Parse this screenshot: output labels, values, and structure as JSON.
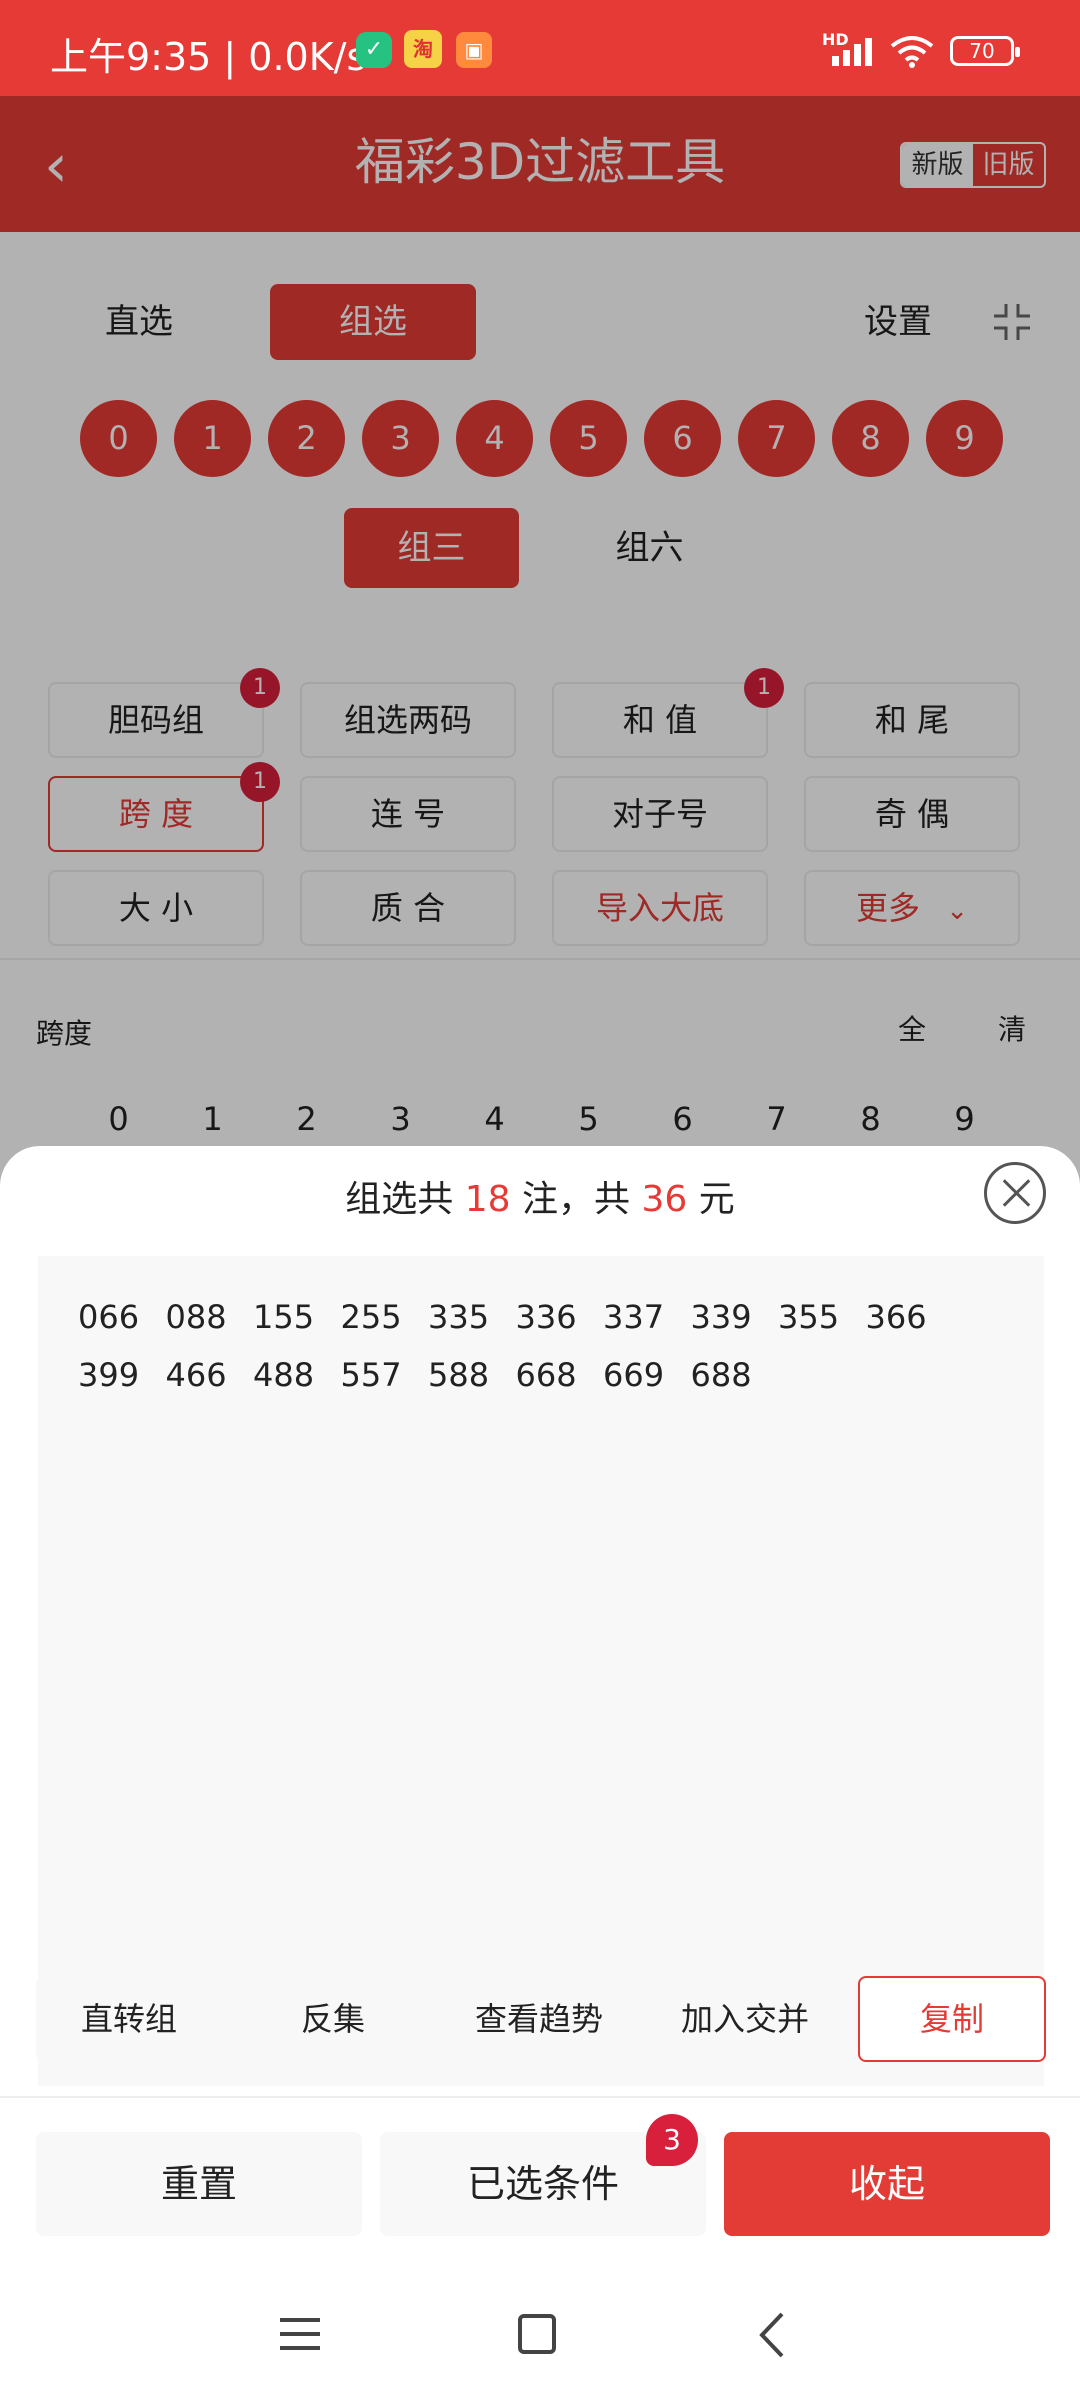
{
  "status_bar": {
    "time": "上午9:35 | 0.0K/s",
    "hd": "HD",
    "battery": "70"
  },
  "title_bar": {
    "title": "福彩3D过滤工具",
    "version_new": "新版",
    "version_old": "旧版"
  },
  "mode_tabs": {
    "direct": "直选",
    "group": "组选",
    "settings": "设置"
  },
  "balls": [
    "0",
    "1",
    "2",
    "3",
    "4",
    "5",
    "6",
    "7",
    "8",
    "9"
  ],
  "group_types": {
    "san": "组三",
    "liu": "组六"
  },
  "conditions": [
    {
      "label": "胆码组",
      "badge": "1"
    },
    {
      "label": "组选两码",
      "badge": ""
    },
    {
      "label": "和 值",
      "badge": "1"
    },
    {
      "label": "和 尾",
      "badge": ""
    },
    {
      "label": "跨 度",
      "badge": "1"
    },
    {
      "label": "连 号",
      "badge": ""
    },
    {
      "label": "对子号",
      "badge": ""
    },
    {
      "label": "奇 偶",
      "badge": ""
    },
    {
      "label": "大 小",
      "badge": ""
    },
    {
      "label": "质 合",
      "badge": ""
    },
    {
      "label": "导入大底",
      "badge": ""
    },
    {
      "label": "更多",
      "badge": ""
    }
  ],
  "span_section": {
    "label": "跨度",
    "all": "全",
    "clear": "清",
    "numbers": [
      "0",
      "1",
      "2",
      "3",
      "4",
      "5",
      "6",
      "7",
      "8",
      "9"
    ]
  },
  "sheet": {
    "prefix": "组选共",
    "count": "18",
    "mid": "注，共",
    "amount": "36",
    "suffix": "元",
    "results": [
      "066",
      "088",
      "155",
      "255",
      "335",
      "336",
      "337",
      "339",
      "355",
      "366",
      "399",
      "466",
      "488",
      "557",
      "588",
      "668",
      "669",
      "688"
    ],
    "actions": {
      "to_group": "直转组",
      "inverse": "反集",
      "trend": "查看趋势",
      "intersect": "加入交并",
      "copy": "复制"
    }
  },
  "footer": {
    "reset": "重置",
    "selected": "已选条件",
    "selected_badge": "3",
    "collapse": "收起"
  },
  "colors": {
    "accent": "#e53a36",
    "badge": "#d81f3b"
  }
}
